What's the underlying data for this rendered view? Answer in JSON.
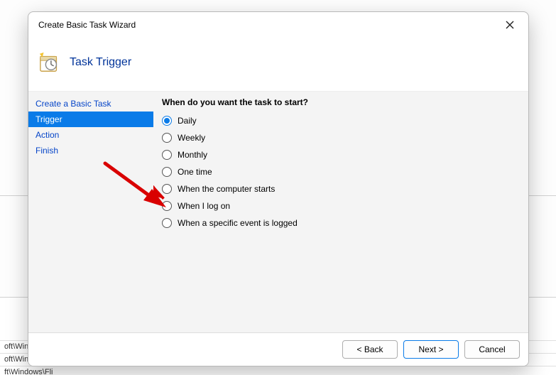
{
  "bg": {
    "line1": "oft\\Wind",
    "line2": "oft\\Windows\\U…",
    "line3_partial": "ft\\Windows\\Fli"
  },
  "dialog": {
    "title": "Create Basic Task Wizard",
    "header_title": "Task Trigger",
    "steps": [
      {
        "label": "Create a Basic Task",
        "active": false
      },
      {
        "label": "Trigger",
        "active": true
      },
      {
        "label": "Action",
        "active": false
      },
      {
        "label": "Finish",
        "active": false
      }
    ],
    "question": "When do you want the task to start?",
    "options": [
      {
        "label": "Daily",
        "checked": true
      },
      {
        "label": "Weekly",
        "checked": false
      },
      {
        "label": "Monthly",
        "checked": false
      },
      {
        "label": "One time",
        "checked": false
      },
      {
        "label": "When the computer starts",
        "checked": false
      },
      {
        "label": "When I log on",
        "checked": false
      },
      {
        "label": "When a specific event is logged",
        "checked": false
      }
    ],
    "buttons": {
      "back": "< Back",
      "next": "Next >",
      "cancel": "Cancel"
    }
  }
}
